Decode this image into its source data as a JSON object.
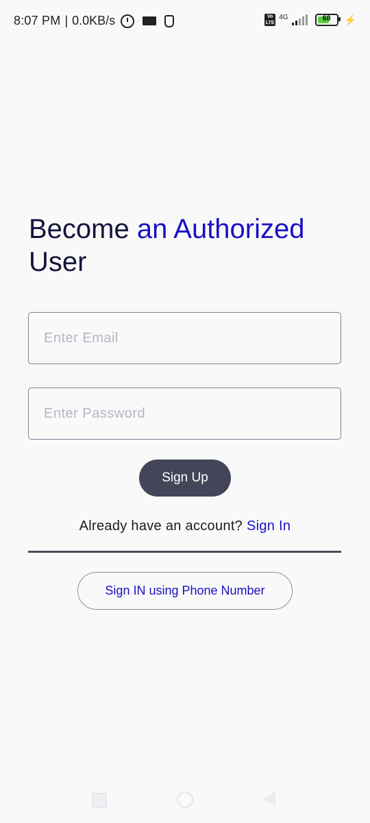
{
  "status_bar": {
    "time": "8:07 PM",
    "separator": "|",
    "speed": "0.0KB/s",
    "network_label": "4G",
    "volte_label": "Vo LTE",
    "battery": "68"
  },
  "heading": {
    "part1": "Become ",
    "part2": "an Authorized",
    "part3": "User"
  },
  "form": {
    "email_placeholder": "Enter Email",
    "password_placeholder": "Enter Password",
    "signup_label": "Sign Up",
    "account_prompt": "Already have an account? ",
    "signin_label": "Sign In",
    "phone_signin_label": "Sign IN using Phone Number"
  },
  "colors": {
    "accent": "#1a10c4",
    "heading": "#14143a",
    "button_bg": "#424658",
    "background": "#f9f9fa"
  }
}
